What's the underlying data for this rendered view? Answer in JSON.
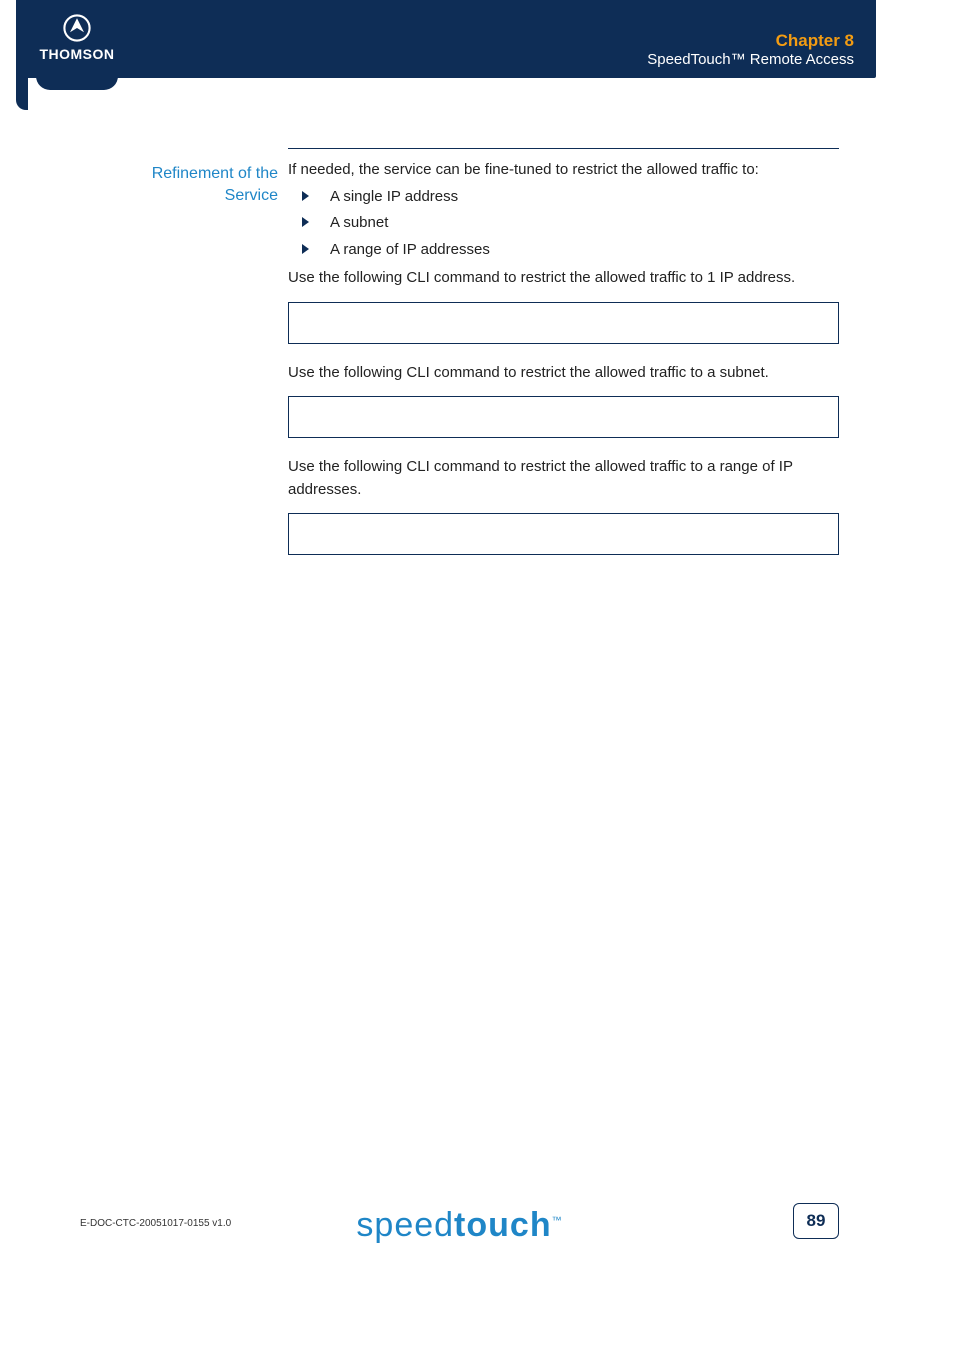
{
  "header": {
    "chapter_label": "Chapter 8",
    "subtitle": "SpeedTouch™ Remote Access"
  },
  "logo": {
    "brand": "THOMSON"
  },
  "section": {
    "side_heading_line1": "Refinement of the",
    "side_heading_line2": "Service",
    "intro": "If needed, the service can be fine-tuned to restrict the allowed traffic to:",
    "bullets": [
      "A single IP address",
      "A subnet",
      "A range of IP addresses"
    ],
    "p_oneip": "Use the following CLI command to restrict the allowed traffic to 1 IP address.",
    "p_subnet": "Use the following CLI command to restrict the allowed traffic to a subnet.",
    "p_range": "Use the following CLI command to restrict the allowed traffic to a range of IP addresses."
  },
  "footer": {
    "doc_id": "E-DOC-CTC-20051017-0155 v1.0",
    "product_logo_light": "speed",
    "product_logo_bold": "touch",
    "tm": "™",
    "page_number": "89"
  }
}
